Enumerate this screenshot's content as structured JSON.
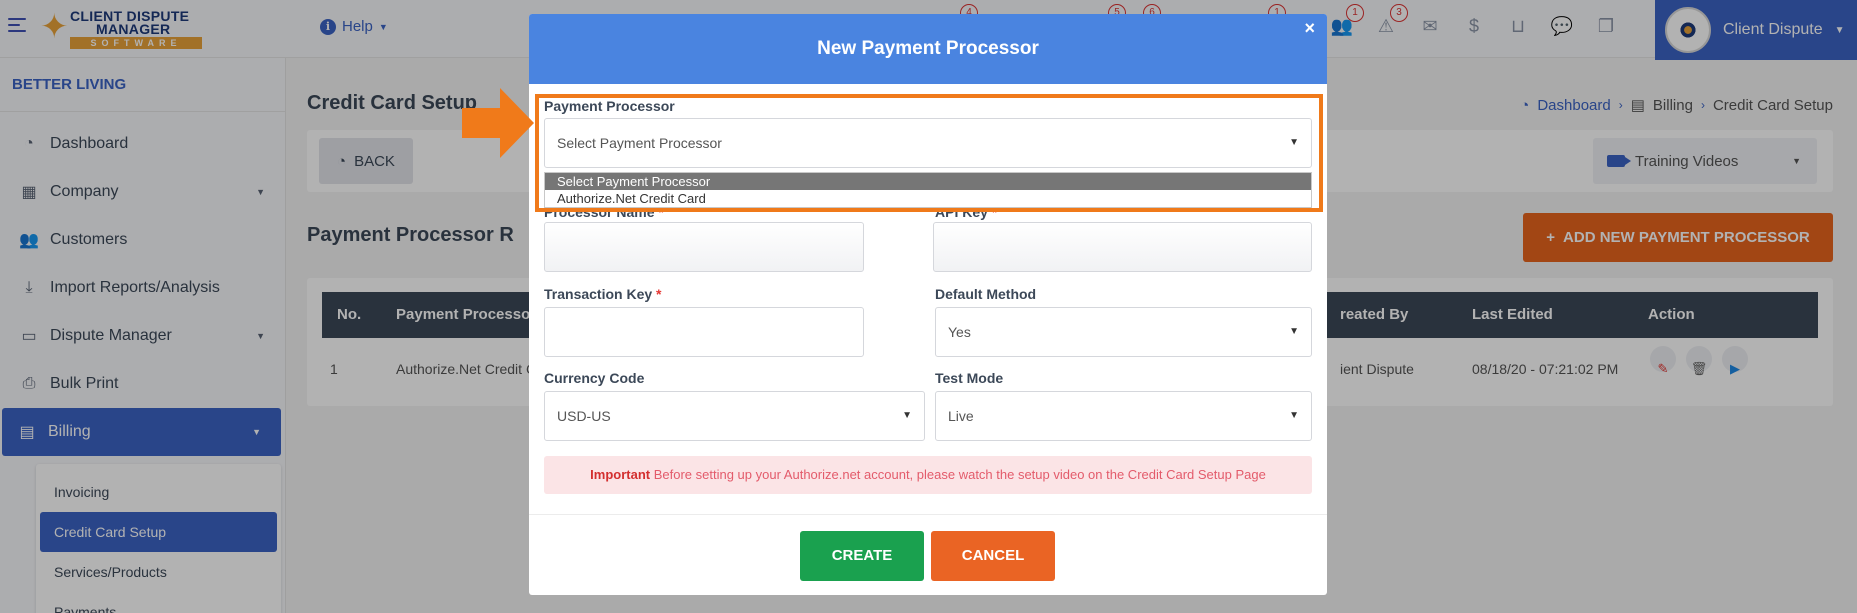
{
  "header": {
    "logo": {
      "line1": "CLIENT DISPUTE",
      "line2": "MANAGER",
      "line3": "SOFTWARE"
    },
    "help_label": "Help",
    "icons": [
      {
        "name": "users-icon",
        "glyph": "👥",
        "badge": "1"
      },
      {
        "name": "alert-icon",
        "glyph": "⚠",
        "badge": "3"
      },
      {
        "name": "inbox-icon",
        "glyph": "✉",
        "badge": ""
      },
      {
        "name": "money-icon",
        "glyph": "$",
        "badge": ""
      },
      {
        "name": "tray-icon",
        "glyph": "⊔",
        "badge": ""
      },
      {
        "name": "chat-icon",
        "glyph": "💬",
        "badge": ""
      },
      {
        "name": "copy-icon",
        "glyph": "❐",
        "badge": ""
      }
    ],
    "ghost_badges": [
      "4",
      "5",
      "6",
      "1"
    ],
    "user_name": "Client Dispute"
  },
  "sidebar": {
    "org_name": "BETTER LIVING",
    "items": [
      {
        "label": "Dashboard",
        "icon": "◔"
      },
      {
        "label": "Company",
        "icon": "▦"
      },
      {
        "label": "Customers",
        "icon": "👥"
      },
      {
        "label": "Import Reports/Analysis",
        "icon": "⤓"
      },
      {
        "label": "Dispute Manager",
        "icon": "▭"
      },
      {
        "label": "Bulk Print",
        "icon": "⎙"
      },
      {
        "label": "Billing",
        "icon": "▤"
      }
    ],
    "sub_items": [
      "Invoicing",
      "Credit Card Setup",
      "Services/Products",
      "Payments"
    ]
  },
  "page": {
    "title": "Credit Card Setup",
    "breadcrumb": [
      "Dashboard",
      "Billing",
      "Credit Card Setup"
    ],
    "back_label": "BACK",
    "training_label": "Training Videos",
    "section_title": "Payment Processor R",
    "add_button_label": "ADD NEW PAYMENT PROCESSOR"
  },
  "table": {
    "headers": [
      "No.",
      "Payment Processor",
      "reated By",
      "Last Edited",
      "Action"
    ],
    "rows": [
      {
        "no": "1",
        "processor": "Authorize.Net Credit C",
        "created_by": "ient Dispute",
        "last_edited": "08/18/20 - 07:21:02 PM"
      }
    ]
  },
  "modal": {
    "title": "New Payment Processor",
    "close": "×",
    "payment_processor_label": "Payment Processor",
    "payment_processor_value": "Select Payment Processor",
    "dropdown_options": [
      "Select Payment Processor",
      "Authorize.Net Credit Card"
    ],
    "processor_name_label": "Processor Name",
    "api_key_label": "API Key",
    "transaction_key_label": "Transaction Key",
    "required_mark": "*",
    "default_method_label": "Default Method",
    "default_method_value": "Yes",
    "currency_code_label": "Currency Code",
    "currency_code_value": "USD-US",
    "test_mode_label": "Test Mode",
    "test_mode_value": "Live",
    "alert_strong": "Important",
    "alert_text": " Before setting up your Authorize.net account, please watch the setup video on the Credit Card Setup Page",
    "create_label": "CREATE",
    "cancel_label": "CANCEL"
  },
  "colors": {
    "brand_blue": "#3b63c4",
    "modal_header": "#4a84e0",
    "accent_orange": "#e8651e",
    "success_green": "#1aa14f",
    "annotation_orange": "#f07a1a"
  }
}
